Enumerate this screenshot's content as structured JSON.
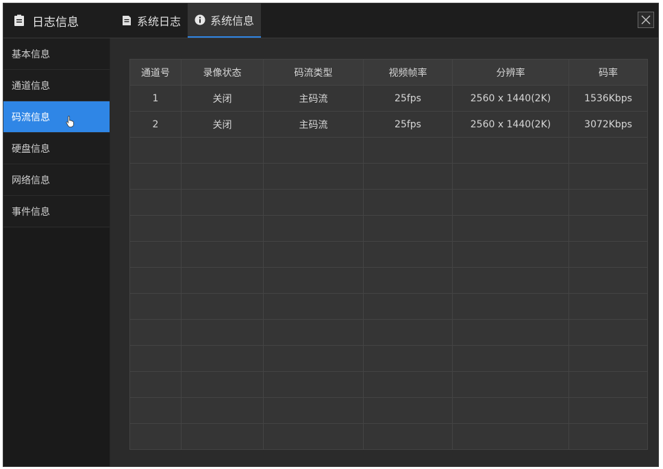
{
  "window": {
    "title": "日志信息",
    "tabs": [
      {
        "label": "系统日志",
        "icon": "document-icon",
        "active": false
      },
      {
        "label": "系统信息",
        "icon": "info-icon",
        "active": true
      }
    ]
  },
  "sidebar": {
    "items": [
      {
        "label": "基本信息",
        "active": false
      },
      {
        "label": "通道信息",
        "active": false
      },
      {
        "label": "码流信息",
        "active": true
      },
      {
        "label": "硬盘信息",
        "active": false
      },
      {
        "label": "网络信息",
        "active": false
      },
      {
        "label": "事件信息",
        "active": false
      }
    ]
  },
  "table": {
    "headers": [
      "通道号",
      "录像状态",
      "码流类型",
      "视频帧率",
      "分辨率",
      "码率"
    ],
    "rows": [
      [
        "1",
        "关闭",
        "主码流",
        "25fps",
        "2560 x 1440(2K)",
        "1536Kbps"
      ],
      [
        "2",
        "关闭",
        "主码流",
        "25fps",
        "2560 x 1440(2K)",
        "3072Kbps"
      ]
    ],
    "empty_rows": 12
  },
  "colors": {
    "accent": "#2f86e6",
    "background": "#262626"
  }
}
